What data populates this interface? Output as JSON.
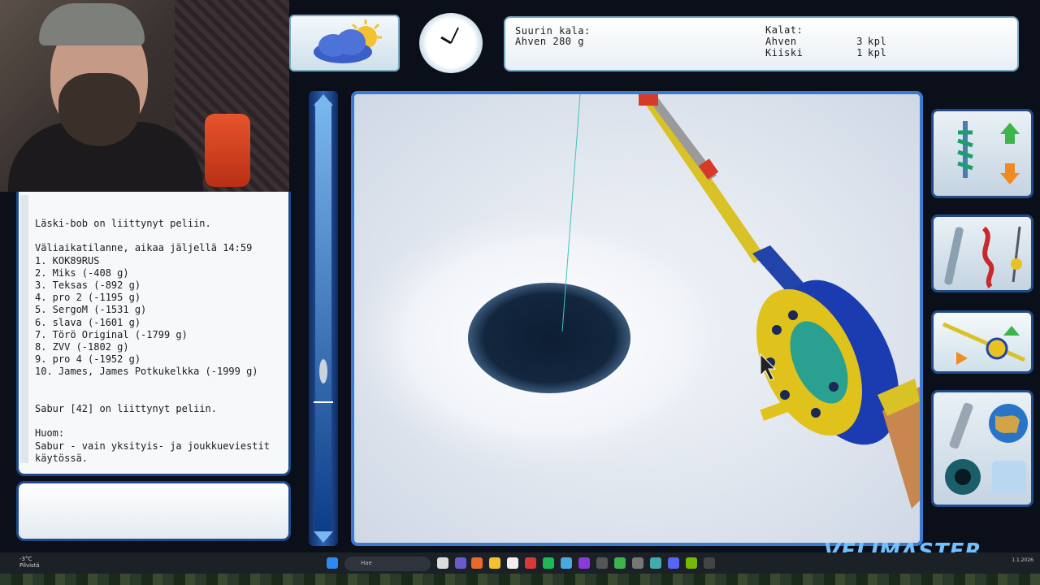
{
  "hud": {
    "biggest_label": "Suurin kala:",
    "biggest_value": "Ahven 280 g",
    "catches_label": "Kalat:",
    "catches": [
      {
        "fish": "Ahven",
        "count": "3",
        "unit": "kpl"
      },
      {
        "fish": "Kiiski",
        "count": "1",
        "unit": "kpl"
      }
    ]
  },
  "chat": {
    "lines": [
      "Läski-bob on liittynyt peliin.",
      "",
      "Väliaikatilanne, aikaa jäljellä 14:59",
      "1. KOK89RUS",
      "2. Miks (-408 g)",
      "3. Teksas (-892 g)",
      "4. pro 2 (-1195 g)",
      "5. SergoM (-1531 g)",
      "6. slava (-1601 g)",
      "7. Törö Original (-1799 g)",
      "8. ZVV (-1802 g)",
      "9. pro 4 (-1952 g)",
      "10. James, James Potkukelkka (-1999 g)",
      "",
      "",
      "Sabur [42] on liittynyt peliin.",
      "",
      "Huom:",
      "Sabur - vain yksityis- ja joukkueviestit",
      "käytössä."
    ]
  },
  "watermark": "VELIMASTER",
  "taskbar": {
    "temp": "-3°C",
    "weather_desc": "Pilvistä",
    "search_placeholder": "Hae",
    "date": "1.1.2026"
  },
  "colors": {
    "panel_border": "#1e4a8c",
    "accent_blue": "#3a7bd0",
    "ice_white": "#f4f6f9",
    "hole_dark": "#0d1e33"
  },
  "icons": [
    "weather-cloud-sun-icon",
    "clock-icon",
    "auger-drill-icon",
    "lures-icon",
    "rod-rig-icon",
    "knife-icon",
    "globe-icon",
    "eye-icon",
    "ice-icon"
  ]
}
